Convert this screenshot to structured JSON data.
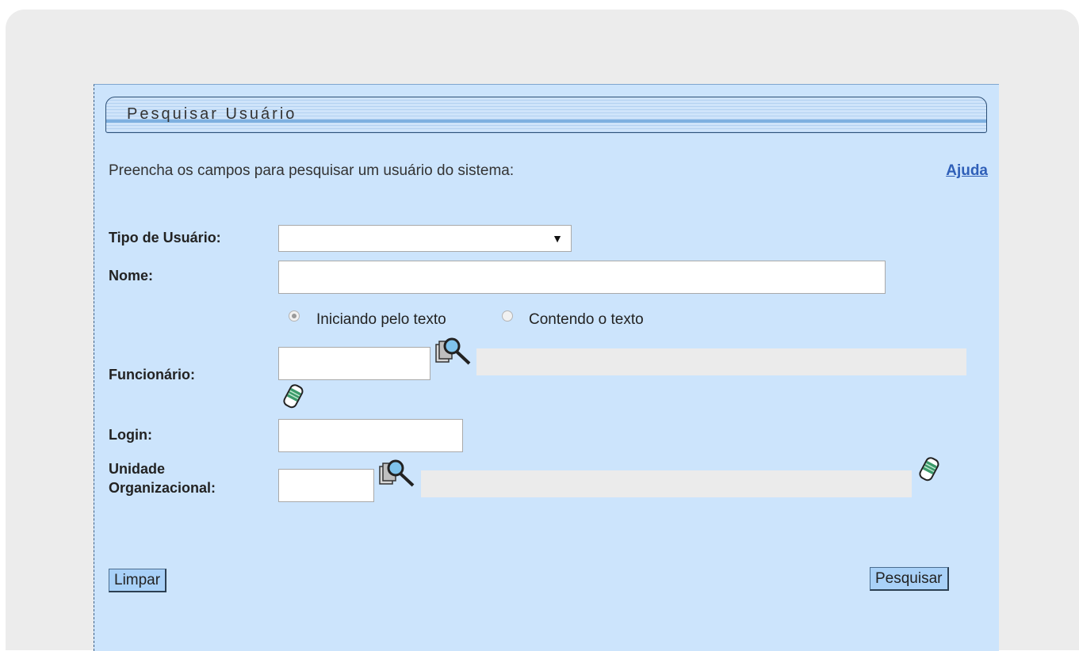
{
  "title": "Pesquisar Usuário",
  "intro": "Preencha os campos para pesquisar um usuário do sistema:",
  "help_link": "Ajuda",
  "fields": {
    "tipo_label": "Tipo de Usuário:",
    "tipo_value": "",
    "nome_label": "Nome:",
    "nome_value": "",
    "radio_iniciando": "Iniciando pelo texto",
    "radio_contendo": "Contendo o texto",
    "funcionario_label": "Funcionário:",
    "funcionario_value": "",
    "login_label": "Login:",
    "login_value": "",
    "unidade_label_line1": "Unidade",
    "unidade_label_line2": "Organizacional:",
    "unidade_value": ""
  },
  "buttons": {
    "limpar": "Limpar",
    "pesquisar": "Pesquisar"
  },
  "icons": {
    "search": "search-lookup-icon",
    "clear": "eraser-icon"
  },
  "colors": {
    "panel_bg": "#cce4fc",
    "link": "#2f5fb8",
    "button_bg": "#a9d1f8"
  }
}
